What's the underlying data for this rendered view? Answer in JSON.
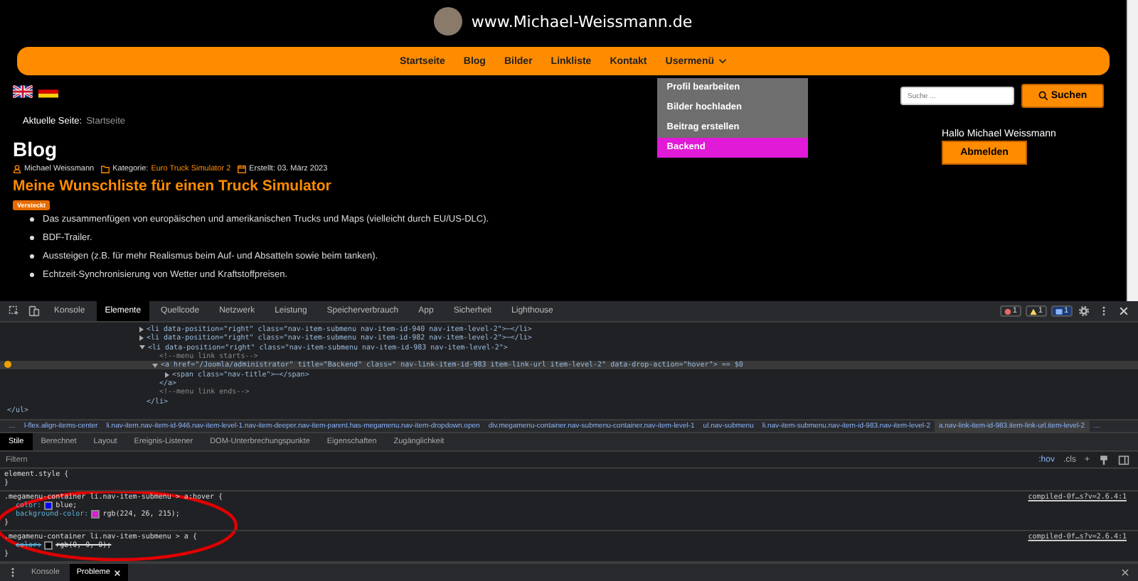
{
  "site": {
    "title": "www.Michael-Weissmann.de"
  },
  "nav": {
    "items": [
      {
        "label": "Startseite"
      },
      {
        "label": "Blog"
      },
      {
        "label": "Bilder"
      },
      {
        "label": "Linkliste"
      },
      {
        "label": "Kontakt"
      },
      {
        "label": "Usermenü",
        "expanded": true,
        "submenu": [
          {
            "label": "Profil bearbeiten",
            "selected": false
          },
          {
            "label": "Bilder hochladen",
            "selected": false
          },
          {
            "label": "Beitrag erstellen",
            "selected": false
          },
          {
            "label": "Backend",
            "selected": true
          }
        ]
      }
    ]
  },
  "search": {
    "placeholder": "Suche ...",
    "button": "Suchen"
  },
  "breadcrumb": {
    "label": "Aktuelle Seite:",
    "current": "Startseite"
  },
  "article": {
    "section": "Blog",
    "author": "Michael Weissmann",
    "category_label": "Kategorie:",
    "category": "Euro Truck Simulator 2",
    "created": "Erstellt: 03. März 2023",
    "title": "Meine Wunschliste für einen Truck Simulator",
    "badge": "Versteckt",
    "items": [
      "Das zusammenfügen von europäischen und amerikanischen Trucks und Maps (vielleicht durch EU/US-DLC).",
      "BDF-Trailer.",
      "Aussteigen (z.B. für mehr Realismus beim Auf- und Absatteln sowie beim tanken).",
      "Echtzeit-Synchronisierung von Wetter und Kraftstoffpreisen."
    ]
  },
  "login": {
    "greeting": "Hallo Michael Weissmann",
    "button": "Abmelden"
  },
  "devtools": {
    "tabs": [
      {
        "label": "Konsole",
        "selected": false
      },
      {
        "label": "Elemente",
        "selected": true
      },
      {
        "label": "Quellcode",
        "selected": false
      },
      {
        "label": "Netzwerk",
        "selected": false
      },
      {
        "label": "Leistung",
        "selected": false
      },
      {
        "label": "Speicherverbrauch",
        "selected": false
      },
      {
        "label": "App",
        "selected": false
      },
      {
        "label": "Sicherheit",
        "selected": false
      },
      {
        "label": "Lighthouse",
        "selected": false
      }
    ],
    "counters": [
      {
        "kind": "error",
        "count": "1"
      },
      {
        "kind": "warning",
        "count": "1"
      },
      {
        "kind": "message",
        "count": "1"
      }
    ],
    "dom": [
      {
        "children": [
          {
            "kind": "tag",
            "text": "<li data-position=\"right\" class=\"nav-item-submenu nav-item-id-940 nav-item-level-2\">⋯</li>",
            "expanded": false,
            "selected": false
          },
          {
            "kind": "tag",
            "text": "<li data-position=\"right\" class=\"nav-item-submenu nav-item-id-982 nav-item-level-2\">⋯</li>",
            "expanded": false,
            "selected": false
          },
          {
            "kind": "tag",
            "text": "<li data-position=\"right\" class=\"nav-item-submenu nav-item-id-983 nav-item-level-2\">",
            "expanded": true,
            "selected": false,
            "children": [
              {
                "kind": "comment",
                "text": "<!--menu link starts-->",
                "selected": false
              },
              {
                "kind": "tag",
                "text": "<a href=\"/Joomla/administrator\" title=\"Backend\" class=\" nav-link-item-id-983 item-link-url item-level-2\" data-drop-action=\"hover\"> == $0",
                "expanded": true,
                "selected": true,
                "children": [
                  {
                    "kind": "tag",
                    "text": "<span class=\"nav-title\">⋯</span>",
                    "expanded": false,
                    "selected": false
                  }
                ]
              },
              {
                "kind": "tag",
                "text": "</a>",
                "selected": false
              },
              {
                "kind": "comment",
                "text": "<!--menu link ends-->",
                "selected": false
              }
            ]
          },
          {
            "kind": "tag",
            "text": "</li>",
            "selected": false
          }
        ]
      },
      {
        "kind": "tag",
        "text": "</ul>",
        "selected": false
      }
    ],
    "crumbs": [
      {
        "label": "…",
        "selected": false
      },
      {
        "label": "l-flex.align-items-center",
        "selected": false
      },
      {
        "label": "li.nav-item.nav-item-id-946.nav-item-level-1.nav-item-deeper.nav-item-parent.has-megamenu.nav-item-dropdown.open",
        "selected": false
      },
      {
        "label": "div.megamenu-container.nav-submenu-container.nav-item-level-1",
        "selected": false
      },
      {
        "label": "ul.nav-submenu",
        "selected": false
      },
      {
        "label": "li.nav-item-submenu.nav-item-id-983.nav-item-level-2",
        "selected": false
      },
      {
        "label": "a.nav-link-item-id-983.item-link-url.item-level-2",
        "selected": true
      },
      {
        "label": "…",
        "selected": false
      }
    ],
    "pane_tabs": [
      {
        "label": "Stile",
        "selected": true
      },
      {
        "label": "Berechnet",
        "selected": false
      },
      {
        "label": "Layout",
        "selected": false
      },
      {
        "label": "Ereignis-Listener",
        "selected": false
      },
      {
        "label": "DOM-Unterbrechungspunkte",
        "selected": false
      },
      {
        "label": "Eigenschaften",
        "selected": false
      },
      {
        "label": "Zugänglichkeit",
        "selected": false
      }
    ],
    "filter": {
      "placeholder": "Filtern",
      "hov": ":hov",
      "cls": ".cls",
      "add": "+"
    },
    "rules": [
      {
        "selector": "element.style {",
        "close": "}"
      },
      {
        "selector": ".megamenu-container li.nav-item-submenu > a:hover {",
        "source": "compiled-0f…s?v=2.6.4:1",
        "close": "}",
        "properties": [
          {
            "name": "color:",
            "value": "blue;",
            "color": "#0000ff",
            "overridden": false
          },
          {
            "name": "background-color:",
            "value": "rgb(224, 26, 215);",
            "color": "#e01ad7",
            "overridden": false
          }
        ]
      },
      {
        "selector": ".megamenu-container li.nav-item-submenu > a {",
        "source": "compiled-0f…s?v=2.6.4:1",
        "close": "}",
        "properties": [
          {
            "name": "color:",
            "value": "rgb(0, 0, 0);",
            "color": "#000000",
            "overridden": true
          }
        ]
      }
    ],
    "drawer_tabs": [
      {
        "label": "Konsole",
        "selected": false,
        "closable": false
      },
      {
        "label": "Probleme",
        "selected": true,
        "closable": true
      }
    ]
  }
}
